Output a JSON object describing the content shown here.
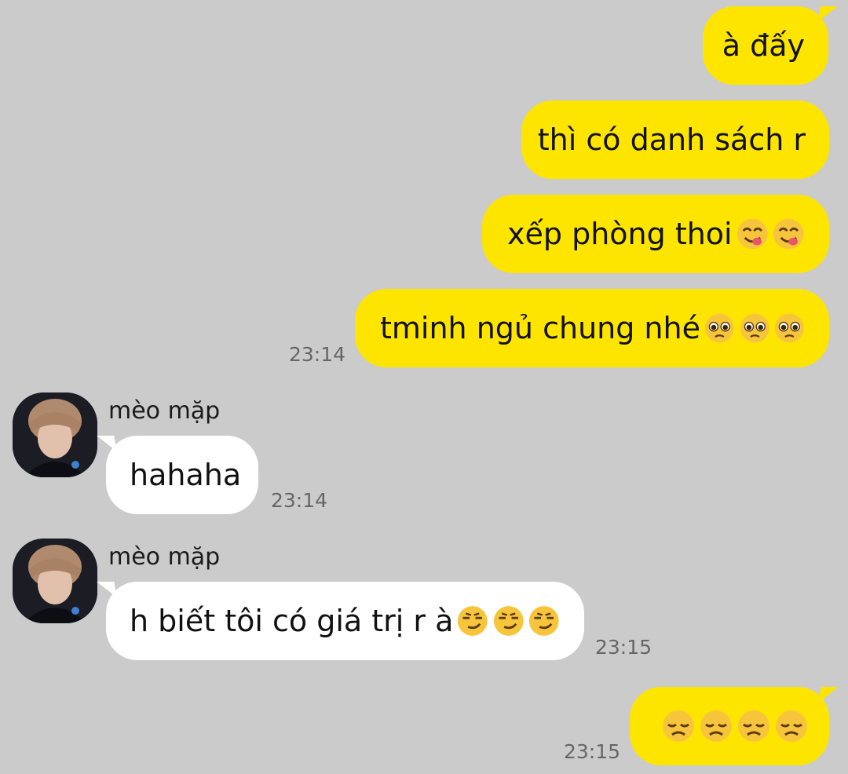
{
  "chat": {
    "messages": [
      {
        "id": "m1",
        "direction": "out",
        "text": "à đấy"
      },
      {
        "id": "m2",
        "direction": "out",
        "text": "thì có danh sách r"
      },
      {
        "id": "m3",
        "direction": "out",
        "text": "xếp phòng thoi",
        "emoji": "savoring-face",
        "emoji_count": 2
      },
      {
        "id": "m4",
        "direction": "out",
        "text": "tminh ngủ chung nhé",
        "emoji": "pleading-face",
        "emoji_count": 3,
        "time": "23:14"
      },
      {
        "id": "m5",
        "direction": "in",
        "sender": "mèo mặp",
        "text": "hahaha",
        "time": "23:14"
      },
      {
        "id": "m6",
        "direction": "in",
        "sender": "mèo mặp",
        "text": "h biết tôi có giá trị r à",
        "emoji": "smirking-face",
        "emoji_count": 3,
        "time": "23:15"
      },
      {
        "id": "m7",
        "direction": "out",
        "text": "",
        "emoji": "disappointed-face",
        "emoji_count": 4,
        "time": "23:15"
      }
    ]
  },
  "colors": {
    "background": "#cbcbcb",
    "outgoing_bubble": "#fee500",
    "incoming_bubble": "#ffffff"
  }
}
